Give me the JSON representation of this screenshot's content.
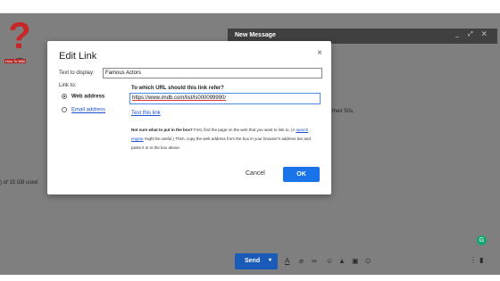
{
  "logo": {
    "symbol": "?",
    "text": "How To Wiki",
    "color": "#c62828"
  },
  "storage": {
    "text": ") of 15 GB used"
  },
  "compose": {
    "title": "New Message",
    "controls": "_ ⤢ ✕",
    "body_text": "their 50s.",
    "send_label": "Send",
    "grammarly_letter": "G",
    "toolbar_icons": [
      "format-text-icon",
      "attach-icon",
      "link-icon",
      "emoji-icon",
      "drive-icon",
      "image-icon",
      "lock-clock-icon"
    ]
  },
  "dialog": {
    "title": "Edit Link",
    "close": "×",
    "text_to_display_label": "Text to display:",
    "text_to_display_value": "Famous Actors",
    "link_to_label": "Link to:",
    "options": [
      {
        "label": "Web address",
        "selected": true
      },
      {
        "label": "Email address",
        "selected": false
      }
    ],
    "url_question": "To which URL should this link refer?",
    "url_value": "https://www.imdb.com/list/ls000099990/",
    "test_link": "Test this link",
    "help_bold": "Not sure what to put in the box?",
    "help_1": " First, find the page on the web that you want to link to. (A ",
    "help_link": "search engine",
    "help_2": " might be useful.) Then, copy the web address from the box in your browser's address bar and paste it in to the box above.",
    "cancel_label": "Cancel",
    "ok_label": "OK"
  },
  "colors": {
    "primary": "#1a73e8",
    "send": "#1a5ab8",
    "overlay": "#7f7f7f"
  }
}
